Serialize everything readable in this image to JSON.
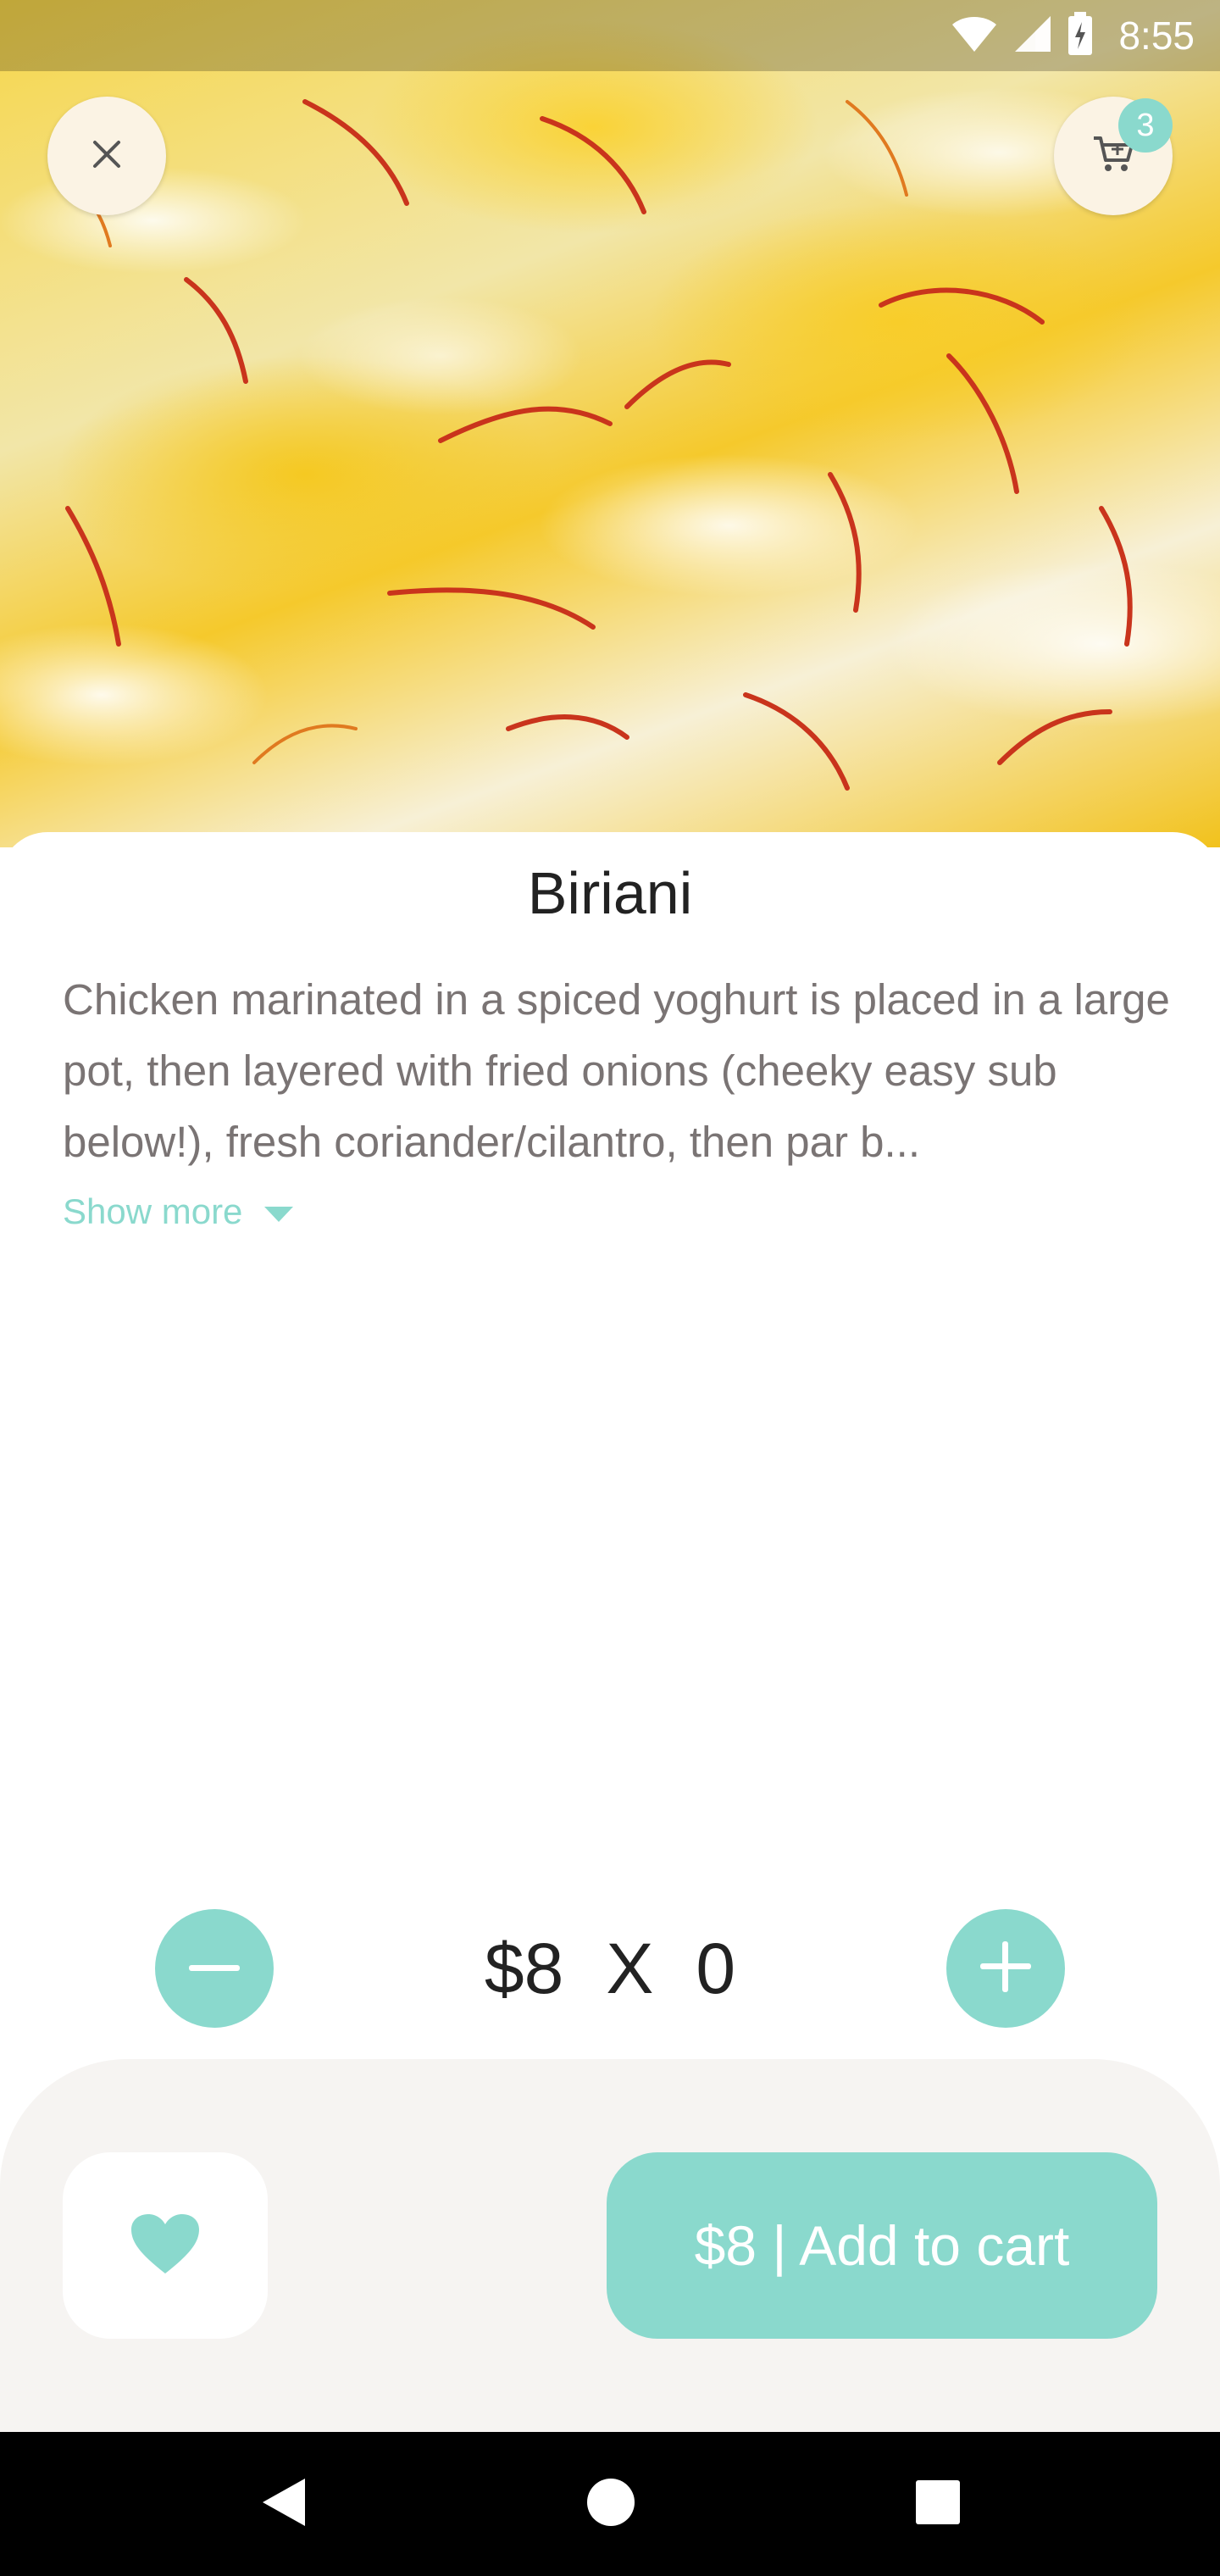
{
  "status_bar": {
    "time": "8:55"
  },
  "cart": {
    "badge_count": "3"
  },
  "product": {
    "title": "Biriani",
    "description": "Chicken marinated in a spiced yoghurt is placed in a large pot, then layered with fried onions (cheeky easy sub below!), fresh coriander/cilantro, then par b...",
    "show_more_label": "Show more"
  },
  "quantity": {
    "price": "$8",
    "times": "X",
    "count": "0"
  },
  "actions": {
    "add_to_cart_label": "$8 | Add to cart"
  },
  "colors": {
    "accent": "#8ad9cd",
    "panel": "#f6f4f2",
    "close_button_bg": "#fbf3e4"
  },
  "icons": [
    "close-icon",
    "cart-icon",
    "caret-down-icon",
    "minus-icon",
    "plus-icon",
    "heart-icon",
    "back-icon",
    "home-icon",
    "recents-icon",
    "wifi-icon",
    "signal-icon",
    "battery-icon"
  ]
}
